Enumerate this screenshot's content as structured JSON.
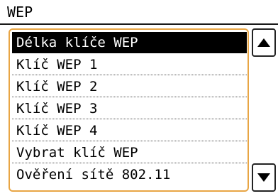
{
  "header": {
    "title": "WEP"
  },
  "menu": {
    "items": [
      {
        "label": "Délka klíče WEP",
        "selected": true
      },
      {
        "label": "Klíč WEP 1",
        "selected": false
      },
      {
        "label": "Klíč WEP 2",
        "selected": false
      },
      {
        "label": "Klíč WEP 3",
        "selected": false
      },
      {
        "label": "Klíč WEP 4",
        "selected": false
      },
      {
        "label": "Vybrat klíč WEP",
        "selected": false
      },
      {
        "label": "Ověření sítě 802.11",
        "selected": false
      }
    ]
  },
  "scrollbar": {
    "up_icon": "triangle-up-icon",
    "down_icon": "triangle-down-icon"
  },
  "colors": {
    "frame_accent": "#e8a544",
    "selected_background": "#000000",
    "selected_text": "#ffffff"
  }
}
